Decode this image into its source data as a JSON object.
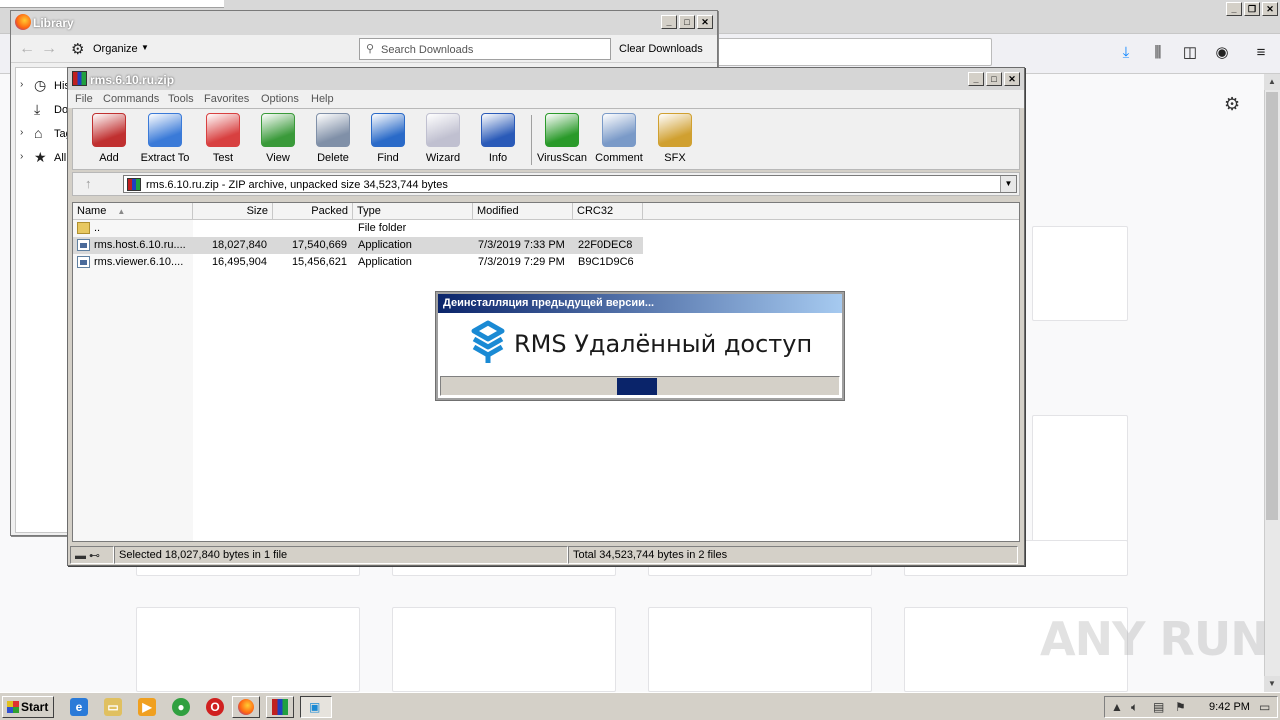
{
  "firefox": {
    "toolbar_icons": [
      "download-icon",
      "library-icon",
      "sidebar-icon",
      "account-icon",
      "menu-icon"
    ],
    "content_icon": "gear-icon"
  },
  "watermark": "ANY RUN",
  "library": {
    "title": "Library",
    "organize_label": "Organize",
    "search_placeholder": "Search Downloads",
    "clear_label": "Clear Downloads",
    "tree": [
      {
        "label": "History",
        "icon": "clock-icon"
      },
      {
        "label": "Downloads",
        "icon": "download-icon"
      },
      {
        "label": "Tags",
        "icon": "tag-icon"
      },
      {
        "label": "All Bookmarks",
        "icon": "star-icon"
      }
    ]
  },
  "winrar": {
    "title": "rms.6.10.ru.zip",
    "menu": [
      "File",
      "Commands",
      "Tools",
      "Favorites",
      "Options",
      "Help"
    ],
    "toolbar": [
      {
        "label": "Add",
        "color": "#c03030"
      },
      {
        "label": "Extract To",
        "color": "#3a7ad8"
      },
      {
        "label": "Test",
        "color": "#d84040"
      },
      {
        "label": "View",
        "color": "#3a9a3a"
      },
      {
        "label": "Delete",
        "color": "#8090a8"
      },
      {
        "label": "Find",
        "color": "#2a6ac8"
      },
      {
        "label": "Wizard",
        "color": "#c0c0d0"
      },
      {
        "label": "Info",
        "color": "#2a5ab8"
      },
      {
        "label": "VirusScan",
        "color": "#2a9a2a"
      },
      {
        "label": "Comment",
        "color": "#7a9ac8"
      },
      {
        "label": "SFX",
        "color": "#d0a030"
      }
    ],
    "path": "rms.6.10.ru.zip - ZIP archive, unpacked size 34,523,744 bytes",
    "columns": [
      "Name",
      "Size",
      "Packed",
      "Type",
      "Modified",
      "CRC32"
    ],
    "rows": [
      {
        "name": "..",
        "size": "",
        "packed": "",
        "type": "File folder",
        "modified": "",
        "crc": "",
        "kind": "folder"
      },
      {
        "name": "rms.host.6.10.ru....",
        "size": "18,027,840",
        "packed": "17,540,669",
        "type": "Application",
        "modified": "7/3/2019 7:33 PM",
        "crc": "22F0DEC8",
        "kind": "app"
      },
      {
        "name": "rms.viewer.6.10....",
        "size": "16,495,904",
        "packed": "15,456,621",
        "type": "Application",
        "modified": "7/3/2019 7:29 PM",
        "crc": "B9C1D9C6",
        "kind": "app"
      }
    ],
    "status_left": "Selected 18,027,840 bytes in 1 file",
    "status_right": "Total 34,523,744 bytes in 2 files"
  },
  "rms_dialog": {
    "title": "Деинсталляция предыдущей версии...",
    "product": "RMS Удалённый доступ",
    "logo_color": "#1a8ad4"
  },
  "taskbar": {
    "start_label": "Start",
    "clock": "9:42 PM"
  }
}
